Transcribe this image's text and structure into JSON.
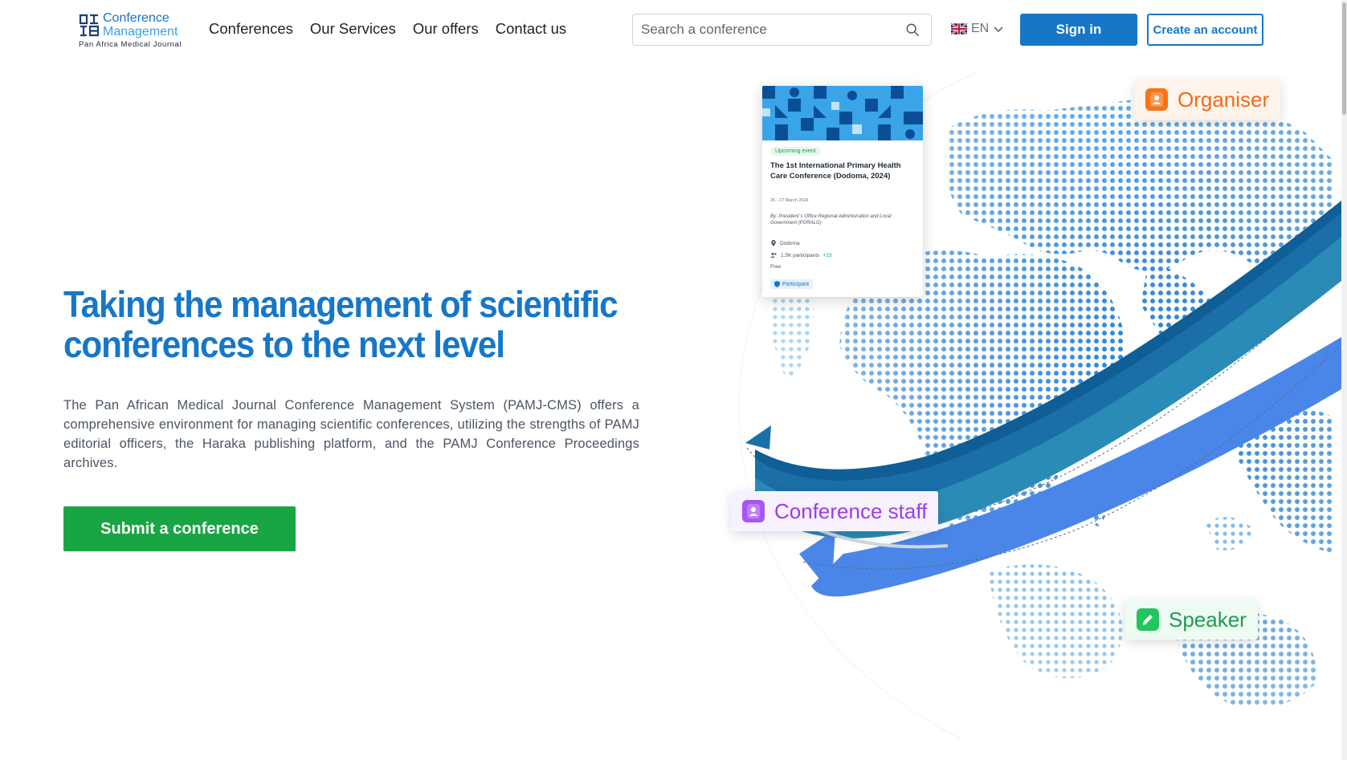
{
  "header": {
    "logo": {
      "line1": "Conference",
      "line2": "Management",
      "line3": "Pan Africa Medical Journal"
    },
    "nav": [
      {
        "label": "Conferences"
      },
      {
        "label": "Our Services"
      },
      {
        "label": "Our offers"
      },
      {
        "label": "Contact us"
      }
    ],
    "search": {
      "placeholder": "Search a conference",
      "icon": "search-icon"
    },
    "language": {
      "code": "EN",
      "flag": "uk-flag-icon"
    },
    "signin_label": "Sign in",
    "create_account_label": "Create an account"
  },
  "hero": {
    "title": "Taking the management of scientific conferences to the next level",
    "description": "The Pan African Medical Journal Conference Management System (PAMJ-CMS) offers a comprehensive environment for managing scientific conferences, utilizing the strengths of PAMJ editorial officers, the Haraka publishing platform, and the PAMJ Conference Proceedings archives.",
    "cta_label": "Submit a conference"
  },
  "illustration": {
    "event_card": {
      "badge": "Upcoming event",
      "title": "The 1st International Primary Health Care Conference (Dodoma, 2024)",
      "date": "25 - 27 March 2024",
      "by": "By: President´s Office Regional Administration and Local Government (PORALG)",
      "location": "Dodoma",
      "participants": "1.5K participants",
      "participants_plus": "+23",
      "price": "Free",
      "role": "Participant"
    },
    "roles": [
      {
        "label": "Organiser",
        "icon": "user-badge-icon",
        "color": "#f97316"
      },
      {
        "label": "Conference staff",
        "icon": "user-badge-icon",
        "color": "#a855f7"
      },
      {
        "label": "Speaker",
        "icon": "pencil-icon",
        "color": "#22c55e"
      }
    ]
  },
  "colors": {
    "primary": "#1677c8",
    "cta": "#1aa545"
  }
}
